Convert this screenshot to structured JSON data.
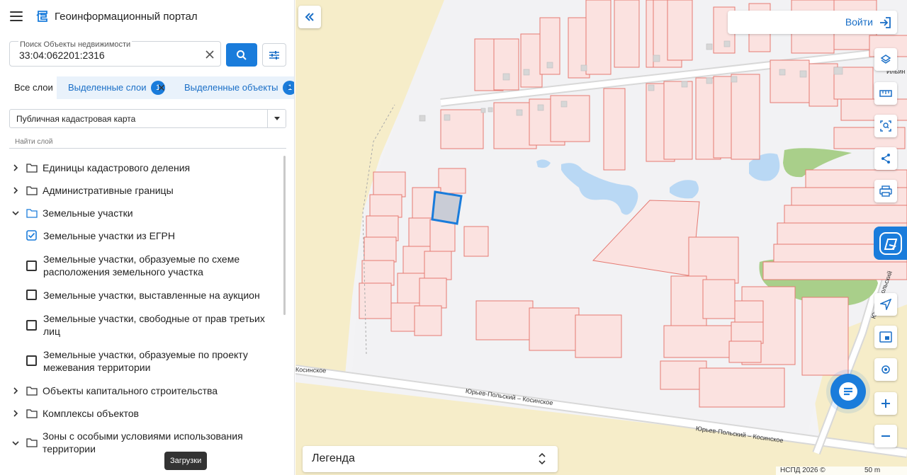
{
  "app": {
    "title": "Геоинформационный портал"
  },
  "search": {
    "label": "Поиск Объекты недвижимости",
    "value": "33:04:062201:2316"
  },
  "tabs": {
    "all_layers": "Все слои",
    "selected_layers": "Выделенные слои",
    "selected_layers_count": "1",
    "selected_objects": "Выделенные объекты",
    "selected_objects_count": "1"
  },
  "basemap": {
    "selected": "Публичная кадастровая карта"
  },
  "layer_search": {
    "placeholder": "Найти слой"
  },
  "tree": [
    {
      "label": "Единицы кадастрового деления",
      "type": "folder",
      "expanded": false
    },
    {
      "label": "Административные границы",
      "type": "folder",
      "expanded": false
    },
    {
      "label": "Земельные участки",
      "type": "folder",
      "expanded": true
    },
    {
      "label": "Земельные участки из ЕГРН",
      "type": "checkbox",
      "checked": true
    },
    {
      "label": "Земельные участки, образуемые по схеме расположения земельного участка",
      "type": "checkbox",
      "checked": false
    },
    {
      "label": "Земельные участки, выставленные на аукцион",
      "type": "checkbox",
      "checked": false
    },
    {
      "label": "Земельные участки, свободные от прав третьих лиц",
      "type": "checkbox",
      "checked": false
    },
    {
      "label": "Земельные участки, образуемые по проекту межевания территории",
      "type": "checkbox",
      "checked": false
    },
    {
      "label": "Объекты капитального строительства",
      "type": "folder",
      "expanded": false
    },
    {
      "label": "Комплексы объектов",
      "type": "folder",
      "expanded": false
    },
    {
      "label": "Зоны с особыми условиями использования территории",
      "type": "folder",
      "expanded": true
    }
  ],
  "tooltip": {
    "text": "Загрузки"
  },
  "map": {
    "login_label": "Войти",
    "legend_label": "Легенда",
    "attribution": "НСПД 2026 ©",
    "scale": "50 m",
    "streets": [
      "Косинское",
      "Юрьев-Польский – Косинское",
      "Юрьев-Польский – Косинское",
      "Ильин",
      "Юрьев-Польский"
    ],
    "icons": [
      "layers-icon",
      "ruler-icon",
      "area-select-icon",
      "share-icon",
      "print-icon",
      "navigate-icon",
      "minimap-icon",
      "location-icon",
      "plus-icon",
      "minus-icon"
    ]
  },
  "colors": {
    "accent": "#1a7cdb",
    "parcel_fill": "#fbe2e0",
    "parcel_stroke": "#e57a72",
    "selected_parcel": "#1a7cdb"
  }
}
